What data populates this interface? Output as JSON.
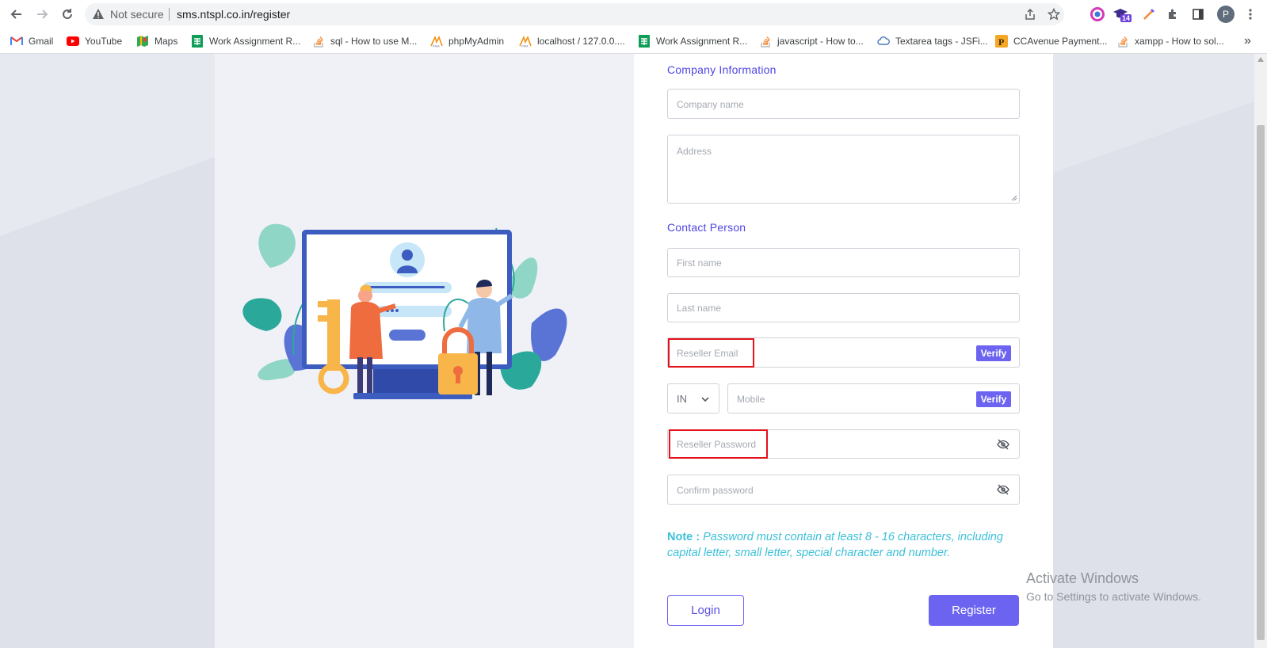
{
  "browser": {
    "security_label": "Not secure",
    "url": "sms.ntspl.co.in/register",
    "profile_initial": "P",
    "extension_badge": "14",
    "overflow_icon": "»"
  },
  "bookmarks": [
    {
      "label": "Gmail",
      "icon": "gmail-icon"
    },
    {
      "label": "YouTube",
      "icon": "youtube-icon"
    },
    {
      "label": "Maps",
      "icon": "maps-icon"
    },
    {
      "label": "Work Assignment R...",
      "icon": "sheets-icon"
    },
    {
      "label": "sql - How to use M...",
      "icon": "stackoverflow-icon"
    },
    {
      "label": "phpMyAdmin",
      "icon": "phpmyadmin-icon"
    },
    {
      "label": "localhost / 127.0.0....",
      "icon": "phpmyadmin-icon"
    },
    {
      "label": "Work Assignment R...",
      "icon": "sheets-icon"
    },
    {
      "label": "javascript - How to...",
      "icon": "stackoverflow-icon"
    },
    {
      "label": "Textarea tags - JSFi...",
      "icon": "jsfiddle-icon"
    },
    {
      "label": "CCAvenue Payment...",
      "icon": "ccavenue-icon"
    },
    {
      "label": "xampp - How to sol...",
      "icon": "stackoverflow-icon"
    }
  ],
  "form": {
    "company_section": "Company Information",
    "company_name_placeholder": "Company name",
    "address_placeholder": "Address",
    "contact_section": "Contact Person",
    "first_name_placeholder": "First name",
    "last_name_placeholder": "Last name",
    "email_placeholder": "Reseller Email",
    "verify_label": "Verify",
    "country_code": "IN",
    "mobile_placeholder": "Mobile",
    "password_placeholder": "Reseller Password",
    "confirm_password_placeholder": "Confirm password",
    "note_label": "Note :",
    "note_text": " Password must contain at least 8 - 16 characters, including capital letter, small letter, special character and number.",
    "login_label": "Login",
    "register_label": "Register"
  },
  "watermark": {
    "title": "Activate Windows",
    "subtitle": "Go to Settings to activate Windows."
  },
  "colors": {
    "accent": "#6c63f0",
    "section_title": "#4f46e5",
    "note": "#3cc0d9",
    "highlight": "#e3121b"
  }
}
